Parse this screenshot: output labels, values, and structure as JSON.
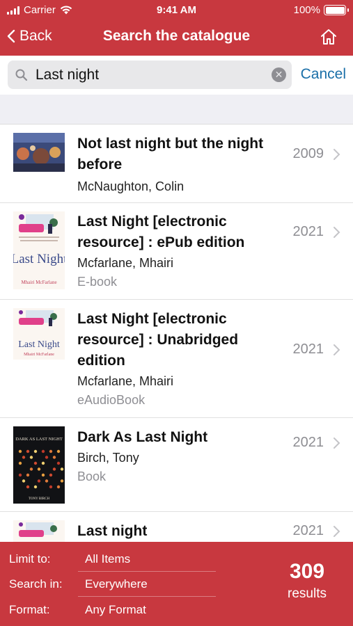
{
  "status": {
    "carrier": "Carrier",
    "time": "9:41 AM",
    "battery": "100%"
  },
  "nav": {
    "back_label": "Back",
    "title": "Search the catalogue",
    "home_icon": "home-icon"
  },
  "search": {
    "query": "Last night",
    "cancel_label": "Cancel"
  },
  "results": [
    {
      "title": "Not last night but the night before",
      "author": "McNaughton, Colin",
      "format": "",
      "year": "2009"
    },
    {
      "title": "Last Night [electronic resource] : ePub edition",
      "author": "Mcfarlane, Mhairi",
      "format": "E-book",
      "year": "2021"
    },
    {
      "title": "Last Night [electronic resource] : Unabridged edition",
      "author": "Mcfarlane, Mhairi",
      "format": "eAudioBook",
      "year": "2021"
    },
    {
      "title": "Dark As Last Night",
      "author": "Birch, Tony",
      "format": "Book",
      "year": "2021"
    },
    {
      "title": "Last night",
      "author": "",
      "format": "",
      "year": "2021"
    }
  ],
  "covers": {
    "last_night_big": "Last Night",
    "author_small": "Mhairi McFarlane",
    "dark_title": "DARK AS LAST NIGHT",
    "dark_author": "TONY BIRCH"
  },
  "filters": {
    "limit": {
      "label": "Limit to:",
      "value": "All Items"
    },
    "search_in": {
      "label": "Search in:",
      "value": "Everywhere"
    },
    "format": {
      "label": "Format:",
      "value": "Any Format"
    }
  },
  "count": {
    "number": "309",
    "label": "results"
  },
  "colors": {
    "brand": "#c8383f",
    "link": "#1a6fa8",
    "muted": "#8e8e93"
  }
}
